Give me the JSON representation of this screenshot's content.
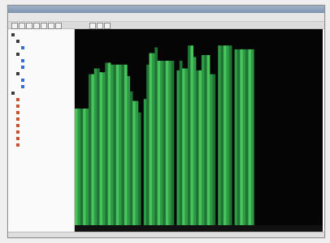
{
  "window": {
    "title": ""
  },
  "menu": {
    "items": [
      "",
      "",
      "",
      "",
      "",
      ""
    ]
  },
  "tree": {
    "items": [
      {
        "label": "",
        "indent": 0,
        "icon_color": "#3d3d3d",
        "selected": false
      },
      {
        "label": "",
        "indent": 1,
        "icon_color": "#3d3d3d",
        "selected": false
      },
      {
        "label": "",
        "indent": 2,
        "icon_color": "#2f6fd6",
        "selected": false
      },
      {
        "label": "",
        "indent": 1,
        "icon_color": "#3d3d3d",
        "selected": false
      },
      {
        "label": "",
        "indent": 2,
        "icon_color": "#2f6fd6",
        "selected": false
      },
      {
        "label": "",
        "indent": 2,
        "icon_color": "#2f6fd6",
        "selected": false
      },
      {
        "label": "",
        "indent": 1,
        "icon_color": "#3d3d3d",
        "selected": false
      },
      {
        "label": "",
        "indent": 2,
        "icon_color": "#2f6fd6",
        "selected": false
      },
      {
        "label": "",
        "indent": 2,
        "icon_color": "#2f6fd6",
        "selected": true
      },
      {
        "label": "",
        "indent": 0,
        "icon_color": "#3d3d3d",
        "selected": false
      },
      {
        "label": "",
        "indent": 1,
        "icon_color": "#c9542e",
        "selected": false
      },
      {
        "label": "",
        "indent": 1,
        "icon_color": "#c9542e",
        "selected": false
      },
      {
        "label": "",
        "indent": 1,
        "icon_color": "#c9542e",
        "selected": false
      },
      {
        "label": "",
        "indent": 1,
        "icon_color": "#c9542e",
        "selected": false
      },
      {
        "label": "",
        "indent": 1,
        "icon_color": "#c9542e",
        "selected": false
      },
      {
        "label": "",
        "indent": 1,
        "icon_color": "#c9542e",
        "selected": false
      },
      {
        "label": "",
        "indent": 1,
        "icon_color": "#c9542e",
        "selected": false
      },
      {
        "label": "",
        "indent": 1,
        "icon_color": "#c9542e",
        "selected": false
      }
    ]
  },
  "chart_data": {
    "type": "bar",
    "ylim": [
      0,
      100
    ],
    "grid": false,
    "colors": {
      "bar": "#2e9a46",
      "bar_highlight": "#49c45d",
      "bar_dark": "#1f7434",
      "background": "#050505"
    },
    "values": [
      61,
      61,
      61,
      61,
      61,
      79,
      79,
      82,
      82,
      80,
      80,
      85,
      85,
      84,
      84,
      84,
      84,
      84,
      84,
      78,
      70,
      65,
      65,
      59,
      0,
      66,
      84,
      90,
      90,
      93,
      86,
      86,
      86,
      86,
      86,
      86,
      0,
      81,
      86,
      82,
      82,
      94,
      94,
      88,
      81,
      81,
      89,
      89,
      89,
      79,
      79,
      0,
      94,
      94,
      94,
      94,
      94,
      0,
      92,
      92,
      92,
      92,
      92,
      92,
      92,
      0,
      0,
      0,
      0,
      0,
      0,
      0,
      0,
      0,
      0,
      0,
      0,
      0,
      0,
      0,
      0,
      0,
      0,
      0,
      0,
      0,
      0,
      0,
      0,
      0
    ]
  },
  "status": {
    "text": ""
  }
}
